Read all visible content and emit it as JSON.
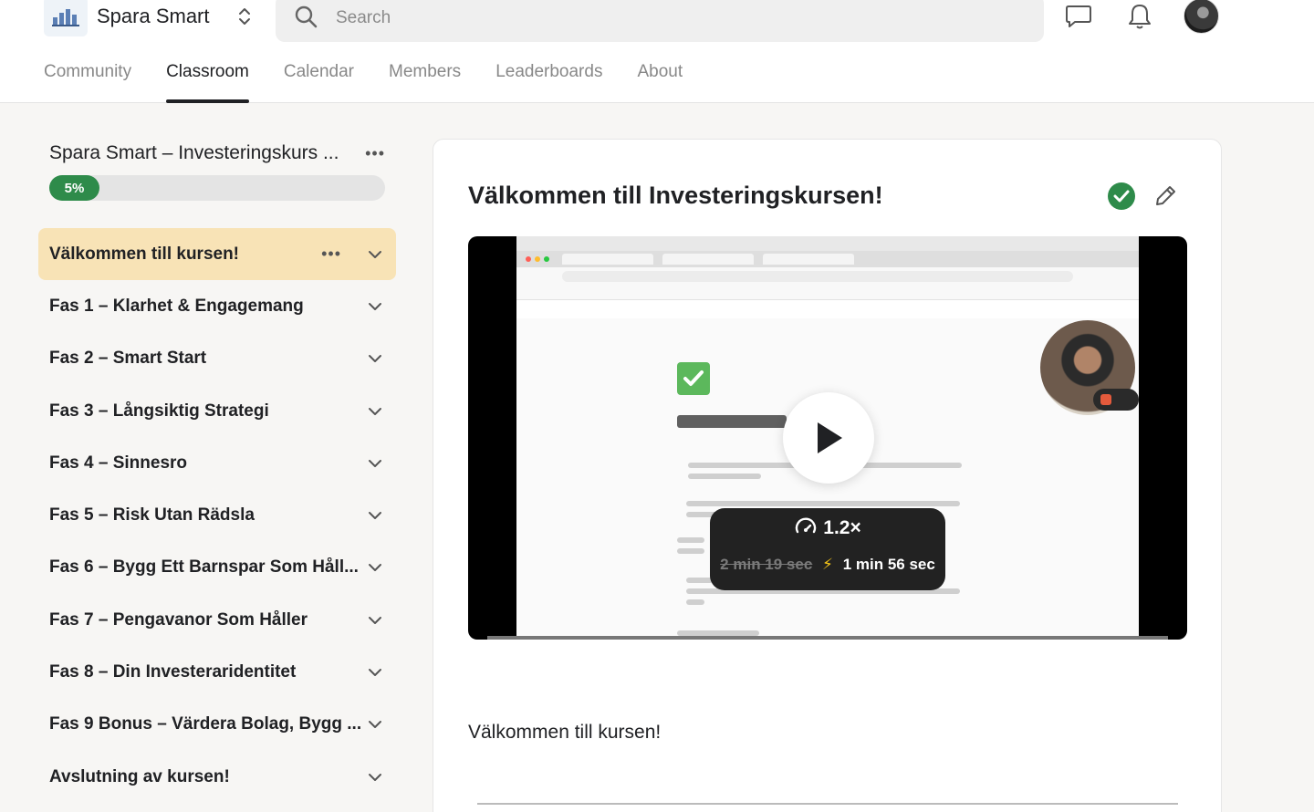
{
  "header": {
    "brand_name": "Spara Smart",
    "search_placeholder": "Search"
  },
  "tabs": [
    {
      "label": "Community",
      "active": false
    },
    {
      "label": "Classroom",
      "active": true
    },
    {
      "label": "Calendar",
      "active": false
    },
    {
      "label": "Members",
      "active": false
    },
    {
      "label": "Leaderboards",
      "active": false
    },
    {
      "label": "About",
      "active": false
    }
  ],
  "sidebar": {
    "course_title": "Spara Smart – Investeringskurs ...",
    "progress_percent": 5,
    "progress_label": "5%",
    "modules": [
      {
        "label": "Välkommen till kursen!",
        "active": true
      },
      {
        "label": "Fas 1 – Klarhet & Engagemang",
        "active": false
      },
      {
        "label": "Fas 2 – Smart Start",
        "active": false
      },
      {
        "label": "Fas 3 – Långsiktig Strategi",
        "active": false
      },
      {
        "label": "Fas 4 – Sinnesro",
        "active": false
      },
      {
        "label": "Fas 5 – Risk Utan Rädsla",
        "active": false
      },
      {
        "label": "Fas 6 – Bygg Ett Barnspar Som Håll...",
        "active": false
      },
      {
        "label": "Fas 7 – Pengavanor Som Håller",
        "active": false
      },
      {
        "label": "Fas 8 – Din Investeraridentitet",
        "active": false
      },
      {
        "label": "Fas 9 Bonus – Värdera Bolag, Bygg ...",
        "active": false
      },
      {
        "label": "Avslutning av kursen!",
        "active": false
      }
    ]
  },
  "lesson": {
    "title": "Välkommen till Investeringskursen!",
    "completed": true,
    "video": {
      "speed": "1.2×",
      "original_duration": "2 min 19 sec",
      "new_duration": "1 min 56 sec"
    },
    "subtitle": "Välkommen till kursen!"
  },
  "colors": {
    "accent_green": "#2e8b4a",
    "active_module_bg": "#f8e3b6",
    "bolt": "#f5c518"
  }
}
